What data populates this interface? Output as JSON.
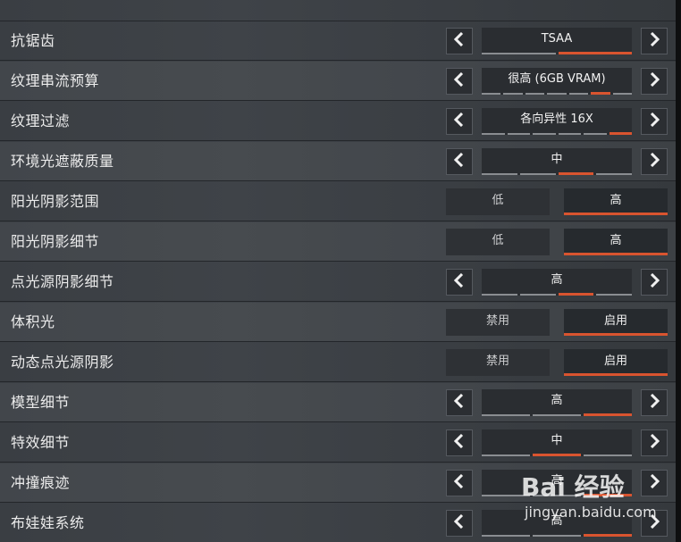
{
  "colors": {
    "accent": "#d9542f",
    "bg": "#3d4146"
  },
  "rows": [
    {
      "label": "抗锯齿",
      "kind": "selector",
      "value": "TSAA",
      "segments": 2,
      "active": 1
    },
    {
      "label": "纹理串流预算",
      "kind": "selector",
      "value": "很高 (6GB VRAM)",
      "segments": 7,
      "active": 5
    },
    {
      "label": "纹理过滤",
      "kind": "selector",
      "value": "各向异性 16X",
      "segments": 6,
      "active": 5
    },
    {
      "label": "环境光遮蔽质量",
      "kind": "selector",
      "value": "中",
      "segments": 4,
      "active": 2
    },
    {
      "label": "阳光阴影范围",
      "kind": "toggle",
      "options": [
        "低",
        "高"
      ],
      "active": 1
    },
    {
      "label": "阳光阴影细节",
      "kind": "toggle",
      "options": [
        "低",
        "高"
      ],
      "active": 1
    },
    {
      "label": "点光源阴影细节",
      "kind": "selector",
      "value": "高",
      "segments": 4,
      "active": 2
    },
    {
      "label": "体积光",
      "kind": "toggle",
      "options": [
        "禁用",
        "启用"
      ],
      "active": 1
    },
    {
      "label": "动态点光源阴影",
      "kind": "toggle",
      "options": [
        "禁用",
        "启用"
      ],
      "active": 1
    },
    {
      "label": "模型细节",
      "kind": "selector",
      "value": "高",
      "segments": 3,
      "active": 2
    },
    {
      "label": "特效细节",
      "kind": "selector",
      "value": "中",
      "segments": 3,
      "active": 1
    },
    {
      "label": "冲撞痕迹",
      "kind": "selector",
      "value": "高",
      "segments": 3,
      "active": 2
    },
    {
      "label": "布娃娃系统",
      "kind": "selector",
      "value": "高",
      "segments": 3,
      "active": 2
    }
  ],
  "icons": {
    "left": "chevron-left-icon",
    "right": "chevron-right-icon"
  },
  "watermark": {
    "text": "Bai 经验",
    "url": "jingyan.baidu.com"
  }
}
